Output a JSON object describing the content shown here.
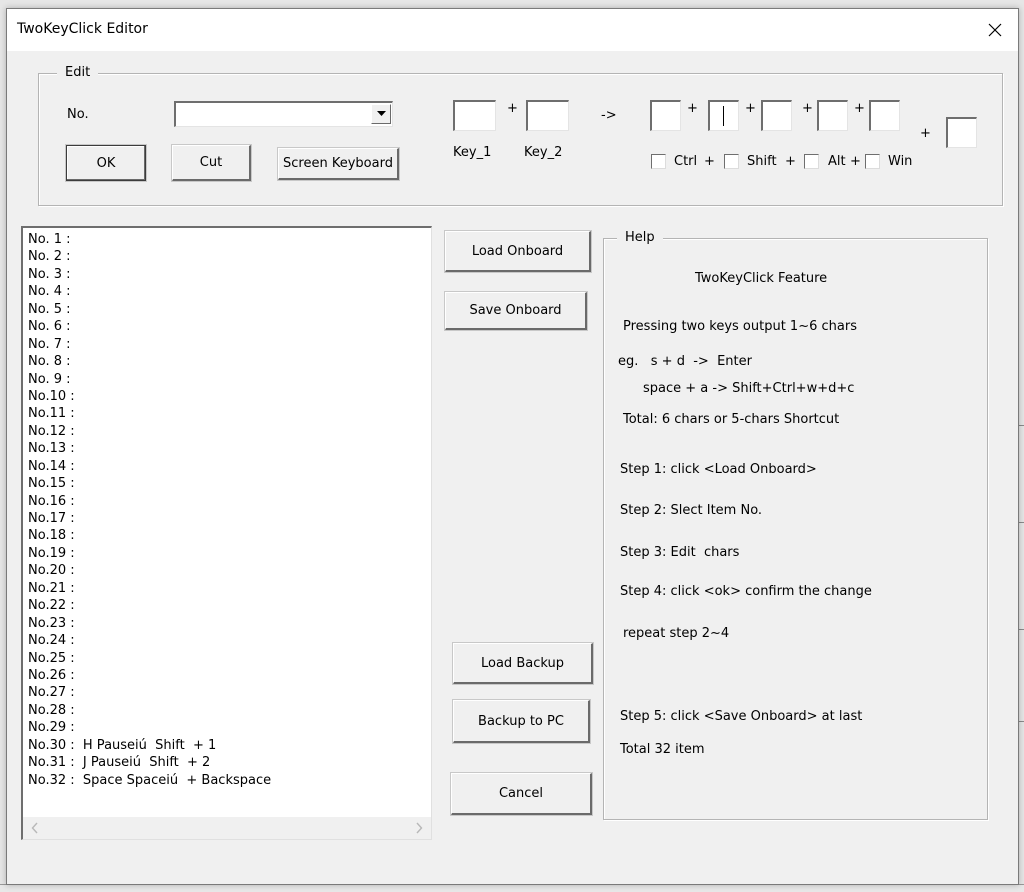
{
  "window": {
    "title": "TwoKeyClick Editor",
    "close_label": "Close"
  },
  "edit_group": {
    "legend": "Edit",
    "no_label": "No.",
    "no_select_value": "",
    "ok_label": "OK",
    "cut_label": "Cut",
    "screen_keyboard_label": "Screen Keyboard",
    "key_inputs": [
      {
        "label": "Key_1",
        "value": ""
      },
      {
        "label": "Key_2",
        "value": ""
      }
    ],
    "plus": "+",
    "arrow": "->",
    "output_inputs": [
      "",
      "",
      "",
      "",
      "",
      ""
    ],
    "modifiers": [
      {
        "label": "Ctrl",
        "checked": false
      },
      {
        "label": "Shift",
        "checked": false
      },
      {
        "label": "Alt",
        "checked": false
      },
      {
        "label": "Win",
        "checked": false
      }
    ]
  },
  "list": {
    "items": [
      "No. 1 :",
      "No. 2 :",
      "No. 3 :",
      "No. 4 :",
      "No. 5 :",
      "No. 6 :",
      "No. 7 :",
      "No. 8 :",
      "No. 9 :",
      "No.10 :",
      "No.11 :",
      "No.12 :",
      "No.13 :",
      "No.14 :",
      "No.15 :",
      "No.16 :",
      "No.17 :",
      "No.18 :",
      "No.19 :",
      "No.20 :",
      "No.21 :",
      "No.22 :",
      "No.23 :",
      "No.24 :",
      "No.25 :",
      "No.26 :",
      "No.27 :",
      "No.28 :",
      "No.29 :",
      "No.30 :  H Pauseiú  Shift  + 1",
      "No.31 :  J Pauseiú  Shift  + 2",
      "No.32 :  Space Spaceiú  + Backspace"
    ]
  },
  "actions": {
    "load_onboard": "Load Onboard",
    "save_onboard": "Save Onboard",
    "load_backup": "Load Backup",
    "backup_to_pc": "Backup to PC",
    "cancel": "Cancel"
  },
  "help": {
    "legend": "Help",
    "title": "TwoKeyClick Feature",
    "lines": [
      "Pressing two keys output 1~6 chars",
      "eg.   s + d  ->  Enter",
      "space + a -> Shift+Ctrl+w+d+c",
      "Total: 6 chars or 5-chars Shortcut",
      "Step 1: click <Load Onboard>",
      "Step 2: Slect Item No.",
      "Step 3: Edit  chars",
      "Step 4: click <ok> confirm the change",
      "repeat step 2~4",
      "Step 5: click <Save Onboard> at last",
      "Total 32 item"
    ]
  }
}
